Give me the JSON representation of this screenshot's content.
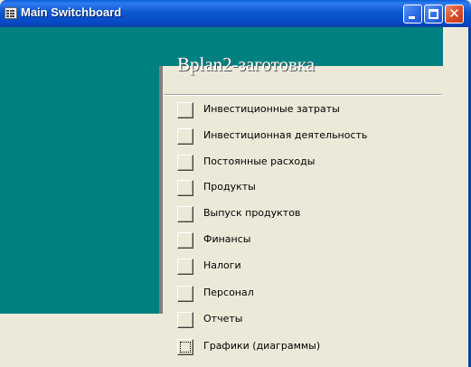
{
  "window": {
    "title": "Main Switchboard",
    "minimize_icon": "minimize-icon",
    "maximize_icon": "maximize-icon",
    "close_icon": "close-icon",
    "close_glyph": "✕"
  },
  "switchboard": {
    "heading": "Bplan2-заготовка",
    "items": [
      {
        "label": "Инвестиционные затраты"
      },
      {
        "label": "Инвестиционная деятельность"
      },
      {
        "label": "Постоянные расходы"
      },
      {
        "label": "Продукты"
      },
      {
        "label": "Выпуск продуктов"
      },
      {
        "label": "Финансы"
      },
      {
        "label": "Налоги"
      },
      {
        "label": "Персонал"
      },
      {
        "label": "Отчеты"
      },
      {
        "label": "Графики (диаграммы)"
      }
    ]
  },
  "colors": {
    "title_bar": "#0a5fd8",
    "teal_panel": "#008080",
    "form_background": "#ece9d8"
  }
}
